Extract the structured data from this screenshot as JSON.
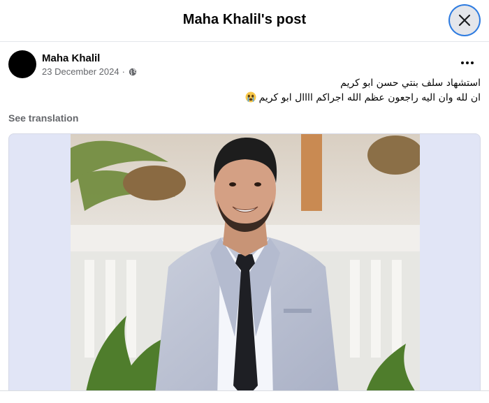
{
  "dialog": {
    "title": "Maha Khalil's post",
    "close_icon": "close-icon"
  },
  "post": {
    "author": "Maha Khalil",
    "date": "23 December 2024",
    "separator": "·",
    "audience_icon": "globe-icon",
    "more_icon": "more-dots-icon",
    "text_line_1": "استشهاد  سلف بنتي حسن ابو كريم",
    "text_line_2": "ان لله وان اليه راجعون عظم الله اجراكم اااال ابو كريم",
    "emoji_icon": "crying-face-emoji",
    "see_translation": "See translation",
    "photo_icon": "photo-man-in-suit"
  },
  "colors": {
    "accent": "#2d7be0",
    "secondary_text": "#65676b",
    "media_background": "#e1e5f6"
  }
}
